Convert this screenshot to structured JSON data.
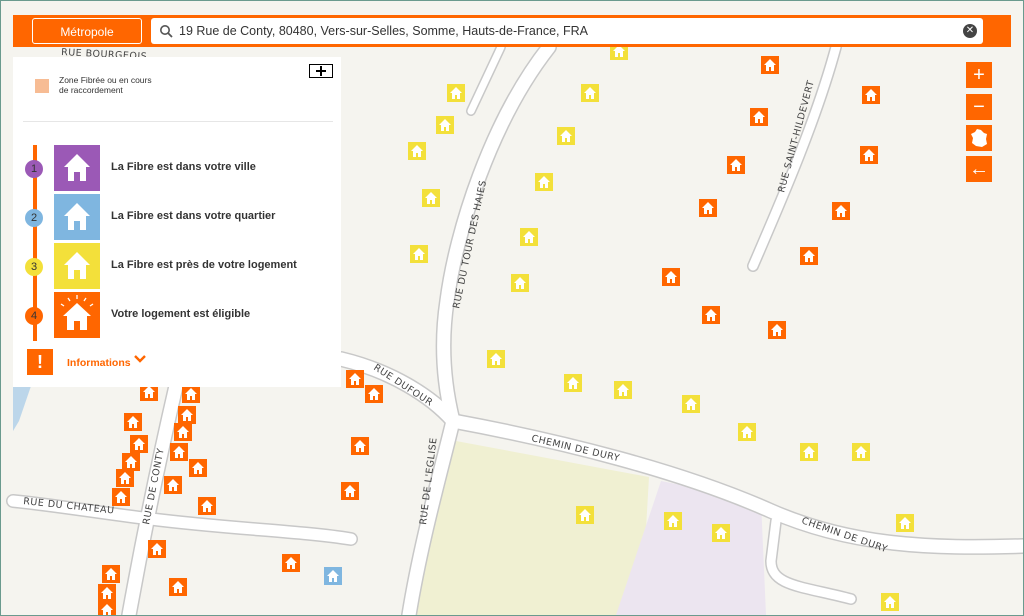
{
  "header": {
    "metro_label": "Métropole",
    "search_value": "19 Rue de Conty, 80480, Vers-sur-Selles, Somme, Hauts-de-France, FRA",
    "search_icon": "search-icon",
    "clear_icon": "clear-icon"
  },
  "legend": {
    "zone_label_line1": "Zone Fibrée ou en cours",
    "zone_label_line2": "de raccordement",
    "zone_color": "#f7bc94",
    "steps": [
      {
        "num": "1",
        "label": "La Fibre est dans votre ville",
        "color": "#9b59b6"
      },
      {
        "num": "2",
        "label": "La Fibre est dans votre quartier",
        "color": "#7fb6e0"
      },
      {
        "num": "3",
        "label": "La Fibre est près de votre logement",
        "color": "#f3e03a"
      },
      {
        "num": "4",
        "label": "Votre logement est éligible",
        "color": "#ff6600"
      }
    ],
    "info_label": "Informations",
    "info_mark": "!"
  },
  "controls": {
    "zoom_in": "+",
    "zoom_out": "−",
    "france_icon": "france-map-icon",
    "back": "←"
  },
  "streets": {
    "bourgeois_partial": "RUE BOURGEOIS",
    "saint_hildevert": "RUE SAINT-HILDEVERT",
    "tour_des_haies": "RUE DU TOUR DES HAIES",
    "dufour": "RUE DUFOUR",
    "chemin_dury_1": "CHEMIN DE DURY",
    "chemin_dury_2": "CHEMIN DE DURY",
    "conty": "RUE DE CONTY",
    "eglise": "RUE DE L'EGLISE",
    "chateau": "RUE DU CHATEAU"
  },
  "colors": {
    "brand_orange": "#ff6600",
    "yellow_marker": "#f3e03a",
    "blue_marker": "#7fb6e0"
  }
}
